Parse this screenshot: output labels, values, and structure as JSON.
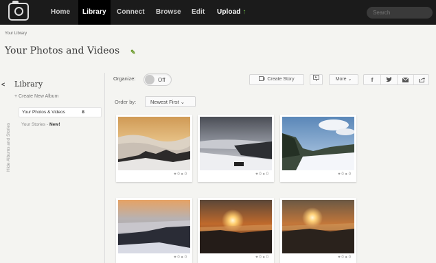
{
  "nav": {
    "items": [
      "Home",
      "Library",
      "Connect",
      "Browse",
      "Edit"
    ],
    "upload_label": "Upload",
    "upload_arrow": "↑",
    "search_placeholder": "Search"
  },
  "breadcrumb": "Your Library",
  "page_title": "Your Photos and Videos",
  "sidebar": {
    "collapse_glyph": "<",
    "vertical_tab_label": "Hide Albums and Stories",
    "heading": "Library",
    "create_album": "+ Create New Album",
    "album_label": "Your Photos & Videos",
    "album_count": "8",
    "stories_label": "Your Stories - ",
    "stories_badge": "New!"
  },
  "toolbar": {
    "organize_label": "Organize:",
    "toggle_text": "Off",
    "toggle_state": "off",
    "create_story_label": "Create Story",
    "more_label": "More",
    "share_icons": [
      "facebook-icon",
      "twitter-icon",
      "email-icon",
      "share-icon"
    ],
    "order_label": "Order by:",
    "order_value": "Newest First"
  },
  "photos": [
    {
      "meta": "♥ 0 ● 0"
    },
    {
      "meta": "♥ 0 ● 0"
    },
    {
      "meta": "♥ 0 ● 0"
    },
    {
      "meta": "♥ 0 ● 0"
    },
    {
      "meta": "♥ 0 ● 0"
    },
    {
      "meta": "♥ 0 ● 0"
    }
  ],
  "colors": {
    "nav_background": "#1b1b1b",
    "page_background": "#f4f4f1",
    "upload_arrow": "#6fbf4a"
  }
}
